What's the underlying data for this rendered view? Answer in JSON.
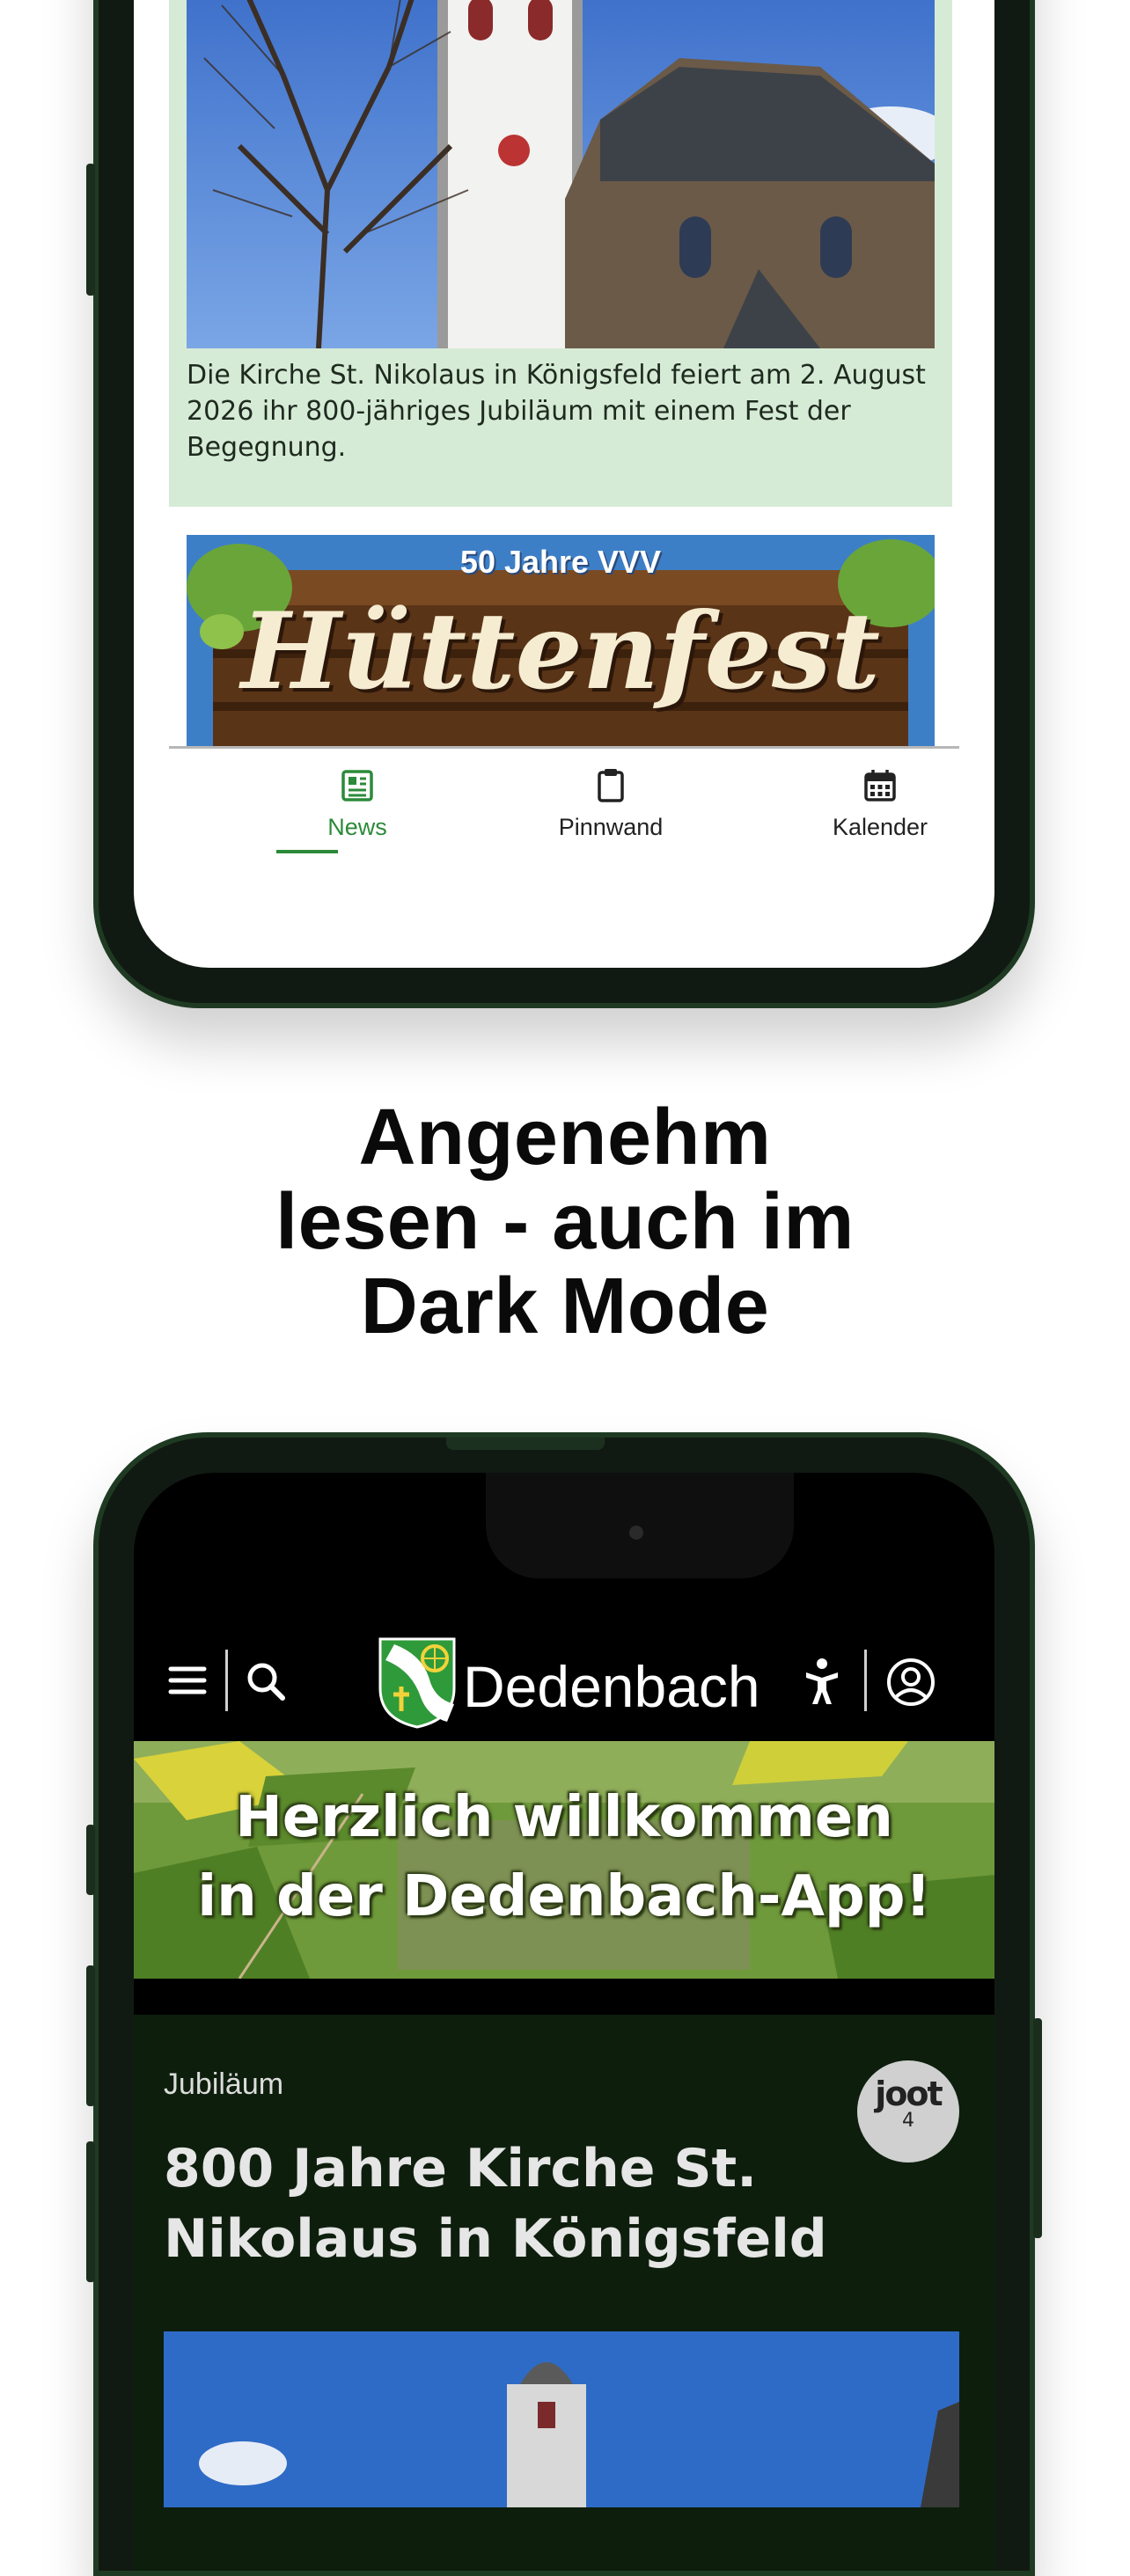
{
  "top_screen": {
    "news": {
      "caption": "Die Kirche St. Nikolaus in Königsfeld feiert am 2. August 2026 ihr 800-jähriges Jubiläum mit einem Fest der Begegnung."
    },
    "banner": {
      "line1": "50 Jahre VVV",
      "line2": "Hüttenfest"
    },
    "tabs": [
      {
        "label": "News",
        "icon": "newspaper-icon",
        "active": true
      },
      {
        "label": "Pinnwand",
        "icon": "clipboard-icon",
        "active": false
      },
      {
        "label": "Kalender",
        "icon": "calendar-icon",
        "active": false
      }
    ]
  },
  "headline": {
    "line1": "Angenehm",
    "line2": "lesen - auch im",
    "line3": "Dark Mode"
  },
  "bottom_screen": {
    "appbar": {
      "title": "Dedenbach",
      "left_icons": [
        "menu-icon",
        "search-icon"
      ],
      "right_icons": [
        "accessibility-icon",
        "profile-icon"
      ]
    },
    "welcome_banner": {
      "line1": "Herzlich willkommen",
      "line2": "in der Dedenbach-App!"
    },
    "article": {
      "category": "Jubiläum",
      "title": "800 Jahre Kirche St. Nikolaus in Königsfeld",
      "badge_label": "joot",
      "badge_count": "4"
    }
  },
  "colors": {
    "accent_green": "#2c8a3a",
    "card_light": "#d6ebd6",
    "card_dark": "#0d1e0d",
    "phone_frame": "#1f3a22"
  }
}
